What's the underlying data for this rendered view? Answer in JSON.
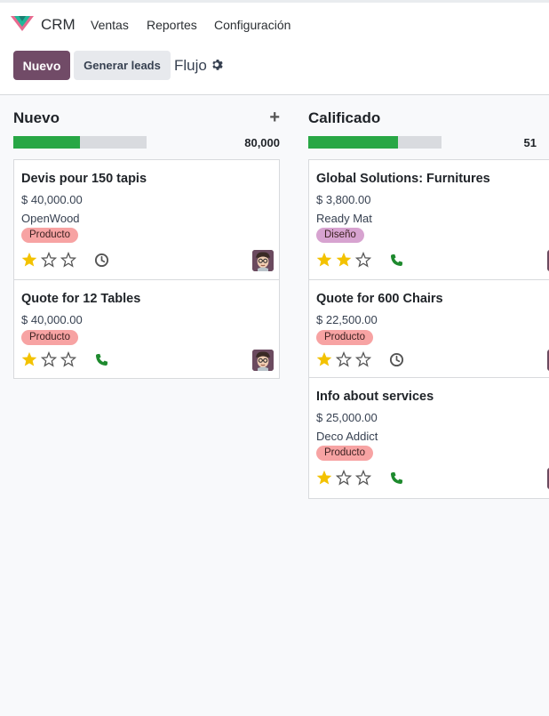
{
  "navbar": {
    "app_name": "CRM",
    "menu": [
      "Ventas",
      "Reportes",
      "Configuración"
    ],
    "logo_icon": "crm-app-icon"
  },
  "control_panel": {
    "new_label": "Nuevo",
    "generate_label": "Generar leads",
    "breadcrumb": "Flujo",
    "settings_icon": "gear-icon"
  },
  "colors": {
    "primary": "#714b67",
    "progress": "#28a745",
    "star_filled": "#f3c200",
    "phone": "#1e8a2e",
    "tag_producto": "#f7a3a3",
    "tag_diseno": "#d7a3d0"
  },
  "columns": [
    {
      "title": "Nuevo",
      "add_icon": "+",
      "progress": 0.5,
      "total": "80,000",
      "cards": [
        {
          "title": "Devis pour 150 tapis",
          "amount": "$ 40,000.00",
          "company": "OpenWood",
          "tag": "Producto",
          "tag_kind": "producto",
          "stars": 1,
          "activity": "clock-icon"
        },
        {
          "title": "Quote for 12 Tables",
          "amount": "$ 40,000.00",
          "company": "",
          "tag": "Producto",
          "tag_kind": "producto",
          "stars": 1,
          "activity": "phone-icon"
        }
      ]
    },
    {
      "title": "Calificado",
      "add_icon": "",
      "progress": 0.67,
      "total": "51",
      "cards": [
        {
          "title": "Global Solutions: Furnitures",
          "amount": "$ 3,800.00",
          "company": "Ready Mat",
          "tag": "Diseño",
          "tag_kind": "diseno",
          "stars": 2,
          "activity": "phone-icon"
        },
        {
          "title": "Quote for 600 Chairs",
          "amount": "$ 22,500.00",
          "company": "",
          "tag": "Producto",
          "tag_kind": "producto",
          "stars": 1,
          "activity": "clock-icon"
        },
        {
          "title": "Info about services",
          "amount": "$ 25,000.00",
          "company": "Deco Addict",
          "tag": "Producto",
          "tag_kind": "producto",
          "stars": 1,
          "activity": "phone-icon"
        }
      ]
    }
  ]
}
